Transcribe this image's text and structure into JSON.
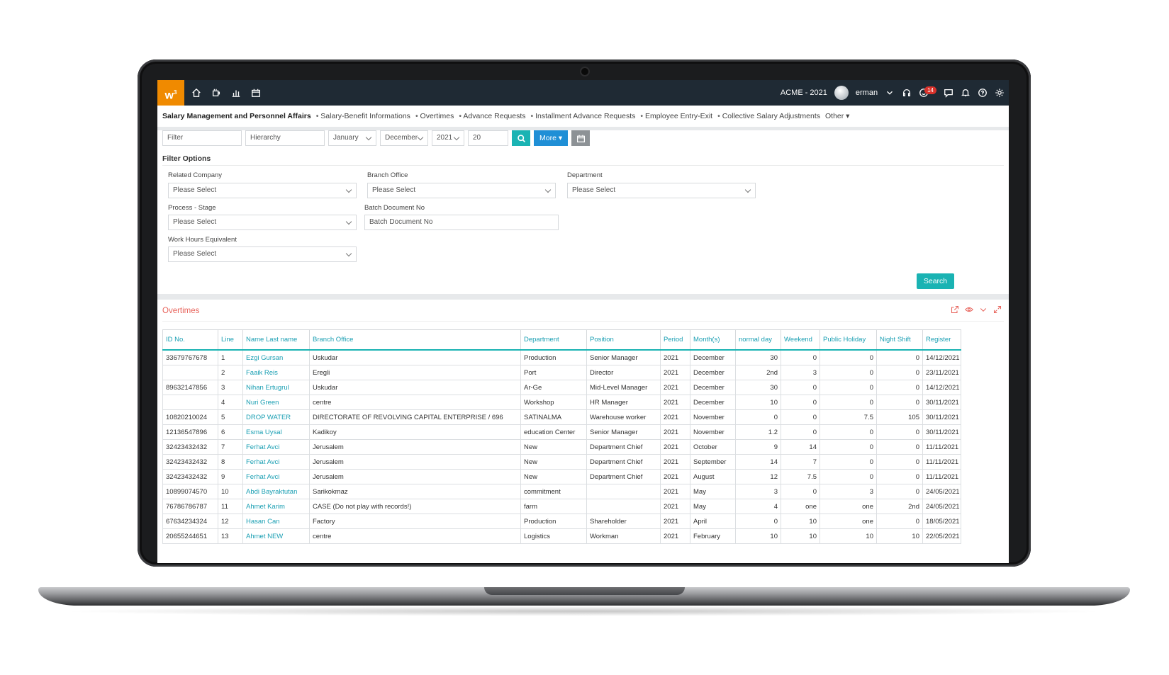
{
  "topbar": {
    "logo": "w",
    "logo_sup": "3",
    "company": "ACME - 2021",
    "user": "erman",
    "notification_count": "14",
    "left_icons": [
      "home-icon",
      "cup-icon",
      "chart-icon",
      "calendar-icon"
    ],
    "right_icons": [
      "headset-icon",
      "smiley-icon",
      "chat-icon",
      "bell-icon",
      "help-icon",
      "gear-icon"
    ]
  },
  "nav": {
    "title": "Salary Management and Personnel Affairs",
    "items": [
      "Salary-Benefit Informations",
      "Overtimes",
      "Advance Requests",
      "Installment Advance Requests",
      "Employee Entry-Exit",
      "Collective Salary Adjustments"
    ],
    "other": "Other"
  },
  "filter": {
    "filter_placeholder": "Filter",
    "hierarchy_placeholder": "Hierarchy",
    "month_from": "January",
    "month_to": "December",
    "year": "2021",
    "count": "20",
    "more": "More"
  },
  "filter_options": {
    "title": "Filter Options",
    "related_company_label": "Related Company",
    "related_company_value": "Please Select",
    "branch_office_label": "Branch Office",
    "branch_office_value": "Please Select",
    "department_label": "Department",
    "department_value": "Please Select",
    "process_stage_label": "Process - Stage",
    "process_stage_value": "Please Select",
    "batch_doc_label": "Batch Document No",
    "batch_doc_placeholder": "Batch Document No",
    "work_hours_label": "Work Hours Equivalent",
    "work_hours_value": "Please Select",
    "search": "Search"
  },
  "overtimes": {
    "title": "Overtimes",
    "columns": [
      "ID No.",
      "Line",
      "Name Last name",
      "Branch Office",
      "Department",
      "Position",
      "Period",
      "Month(s)",
      "normal day",
      "Weekend",
      "Public Holiday",
      "Night Shift",
      "Register"
    ],
    "rows": [
      [
        "33679767678",
        "1",
        "Ezgi Gursan",
        "Uskudar",
        "Production",
        "Senior Manager",
        "2021",
        "December",
        "30",
        "0",
        "0",
        "0",
        "14/12/2021"
      ],
      [
        "",
        "2",
        "Faaik Reis",
        "Eregli",
        "Port",
        "Director",
        "2021",
        "December",
        "2nd",
        "3",
        "0",
        "0",
        "23/11/2021"
      ],
      [
        "89632147856",
        "3",
        "Nihan Ertugrul",
        "Uskudar",
        "Ar-Ge",
        "Mid-Level Manager",
        "2021",
        "December",
        "30",
        "0",
        "0",
        "0",
        "14/12/2021"
      ],
      [
        "",
        "4",
        "Nuri Green",
        "centre",
        "Workshop",
        "HR Manager",
        "2021",
        "December",
        "10",
        "0",
        "0",
        "0",
        "30/11/2021"
      ],
      [
        "10820210024",
        "5",
        "DROP WATER",
        "DIRECTORATE OF REVOLVING CAPITAL ENTERPRISE / 696",
        "SATINALMA",
        "Warehouse worker",
        "2021",
        "November",
        "0",
        "0",
        "7.5",
        "105",
        "30/11/2021"
      ],
      [
        "12136547896",
        "6",
        "Esma Uysal",
        "Kadikoy",
        "education Center",
        "Senior Manager",
        "2021",
        "November",
        "1.2",
        "0",
        "0",
        "0",
        "30/11/2021"
      ],
      [
        "32423432432",
        "7",
        "Ferhat Avci",
        "Jerusalem",
        "New",
        "Department Chief",
        "2021",
        "October",
        "9",
        "14",
        "0",
        "0",
        "11/11/2021"
      ],
      [
        "32423432432",
        "8",
        "Ferhat Avci",
        "Jerusalem",
        "New",
        "Department Chief",
        "2021",
        "September",
        "14",
        "7",
        "0",
        "0",
        "11/11/2021"
      ],
      [
        "32423432432",
        "9",
        "Ferhat Avci",
        "Jerusalem",
        "New",
        "Department Chief",
        "2021",
        "August",
        "12",
        "7.5",
        "0",
        "0",
        "11/11/2021"
      ],
      [
        "10899074570",
        "10",
        "Abdi Bayraktutan",
        "Sarikokmaz",
        "commitment",
        "",
        "2021",
        "May",
        "3",
        "0",
        "3",
        "0",
        "24/05/2021"
      ],
      [
        "76786786787",
        "11",
        "Ahmet Karim",
        "CASE (Do not play with records!)",
        "farm",
        "",
        "2021",
        "May",
        "4",
        "one",
        "one",
        "2nd",
        "24/05/2021"
      ],
      [
        "67634234324",
        "12",
        "Hasan Can",
        "Factory",
        "Production",
        "Shareholder",
        "2021",
        "April",
        "0",
        "10",
        "one",
        "0",
        "18/05/2021"
      ],
      [
        "20655244651",
        "13",
        "Ahmet NEW",
        "centre",
        "Logistics",
        "Workman",
        "2021",
        "February",
        "10",
        "10",
        "10",
        "10",
        "22/05/2021"
      ]
    ]
  }
}
